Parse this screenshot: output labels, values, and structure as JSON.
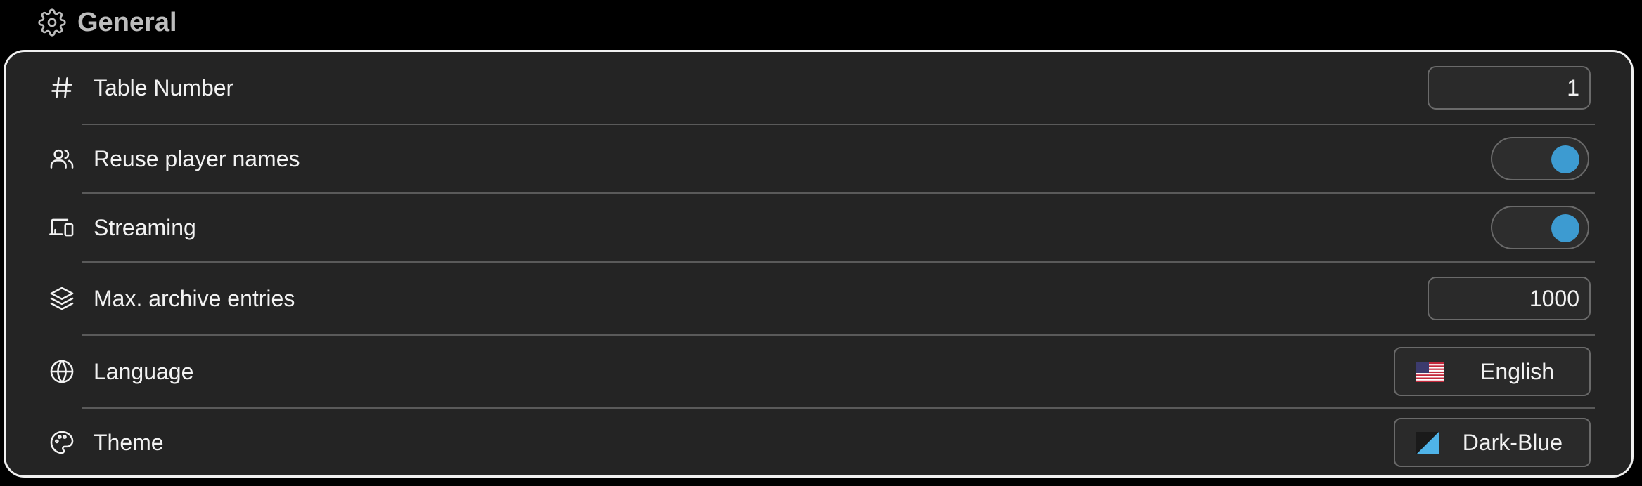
{
  "section": {
    "title": "General",
    "icon": "gear-icon"
  },
  "settings": {
    "table_number": {
      "label": "Table Number",
      "icon": "hash-icon",
      "value": "1"
    },
    "reuse_player_names": {
      "label": "Reuse player names",
      "icon": "users-icon",
      "enabled": true
    },
    "streaming": {
      "label": "Streaming",
      "icon": "devices-icon",
      "enabled": true
    },
    "max_archive_entries": {
      "label": "Max. archive entries",
      "icon": "layers-icon",
      "value": "1000"
    },
    "language": {
      "label": "Language",
      "icon": "globe-icon",
      "value": "English",
      "value_icon": "us-flag-icon"
    },
    "theme": {
      "label": "Theme",
      "icon": "palette-icon",
      "value": "Dark-Blue",
      "value_icon": "theme-swatch-icon"
    }
  },
  "colors": {
    "accent": "#3d9bd1",
    "panel_bg": "#242424",
    "page_bg": "#000000"
  }
}
